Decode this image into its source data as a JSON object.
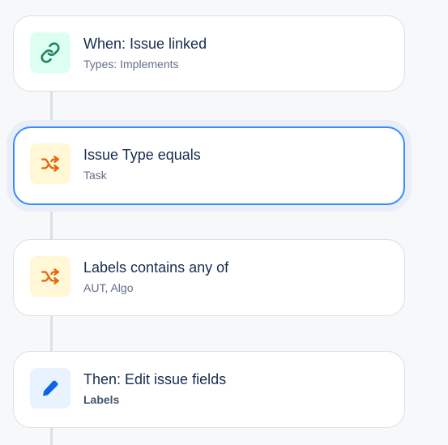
{
  "colors": {
    "page_bg": "#f7f8f9",
    "card_border": "#dcdfe4",
    "selected_border": "#388bff",
    "trigger_icon_bg": "#dcfff1",
    "trigger_icon": "#1f845a",
    "condition_icon_bg": "#fff7d6",
    "condition_icon": "#e56910",
    "action_icon_bg": "#e9f2ff",
    "action_icon": "#0c66e4"
  },
  "rule": {
    "trigger": {
      "icon": "link-icon",
      "title": "When: Issue linked",
      "subtitle": "Types: Implements"
    },
    "conditions": [
      {
        "icon": "shuffle-icon",
        "title": "Issue Type equals",
        "subtitle": "Task",
        "selected": true
      },
      {
        "icon": "shuffle-icon",
        "title": "Labels contains any of",
        "subtitle": "AUT, Algo",
        "selected": false
      }
    ],
    "action": {
      "icon": "pencil-icon",
      "title": "Then: Edit issue fields",
      "subtitle": "Labels"
    }
  }
}
